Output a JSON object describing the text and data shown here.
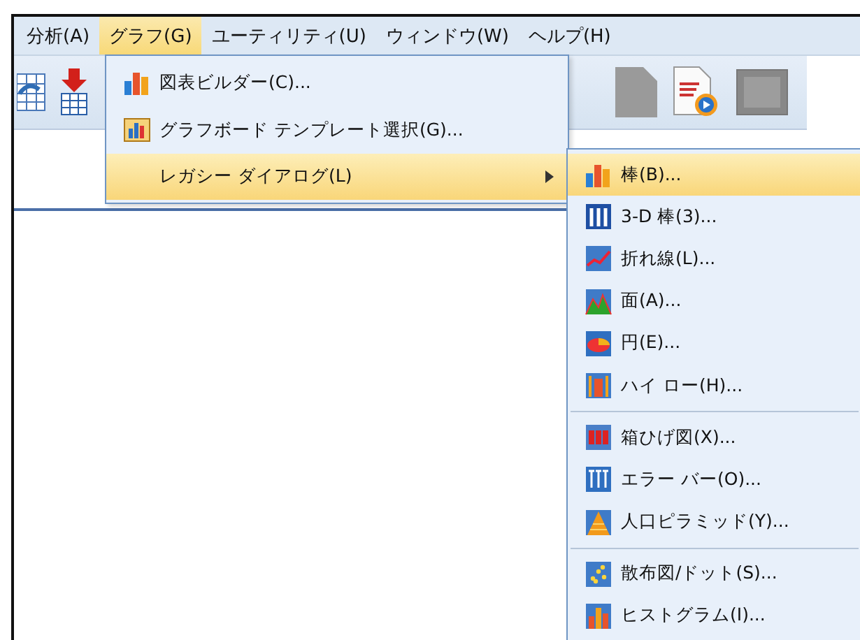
{
  "menubar": [
    {
      "label": "分析(A)",
      "selected": false
    },
    {
      "label": "グラフ(G)",
      "selected": true
    },
    {
      "label": "ユーティリティ(U)",
      "selected": false
    },
    {
      "label": "ウィンドウ(W)",
      "selected": false
    },
    {
      "label": "ヘルプ(H)",
      "selected": false
    }
  ],
  "toolbar": [
    {
      "kind": "table"
    },
    {
      "kind": "import"
    },
    {
      "kind": "spacer"
    },
    {
      "kind": "document"
    },
    {
      "kind": "script"
    },
    {
      "kind": "frame"
    }
  ],
  "graph_menu": [
    {
      "label": "図表ビルダー(C)...",
      "kind": "bar",
      "selected": false,
      "submenu": false
    },
    {
      "label": "グラフボード テンプレート選択(G)...",
      "kind": "board",
      "selected": false,
      "submenu": false
    },
    {
      "label": "レガシー ダイアログ(L)",
      "kind": "none",
      "selected": true,
      "submenu": true
    }
  ],
  "legacy_submenu": [
    [
      {
        "label": "棒(B)...",
        "kind": "bar",
        "selected": true
      },
      {
        "label": "3-D 棒(3)...",
        "kind": "bar3d",
        "selected": false
      },
      {
        "label": "折れ線(L)...",
        "kind": "line",
        "selected": false
      },
      {
        "label": "面(A)...",
        "kind": "area",
        "selected": false
      },
      {
        "label": "円(E)...",
        "kind": "pie",
        "selected": false
      },
      {
        "label": "ハイ ロー(H)...",
        "kind": "highlow",
        "selected": false
      }
    ],
    [
      {
        "label": "箱ひげ図(X)...",
        "kind": "box",
        "selected": false
      },
      {
        "label": "エラー バー(O)...",
        "kind": "error",
        "selected": false
      },
      {
        "label": "人口ピラミッド(Y)...",
        "kind": "pyramid",
        "selected": false
      }
    ],
    [
      {
        "label": "散布図/ドット(S)...",
        "kind": "scatter",
        "selected": false
      },
      {
        "label": "ヒストグラム(I)...",
        "kind": "histogram",
        "selected": false
      }
    ]
  ]
}
